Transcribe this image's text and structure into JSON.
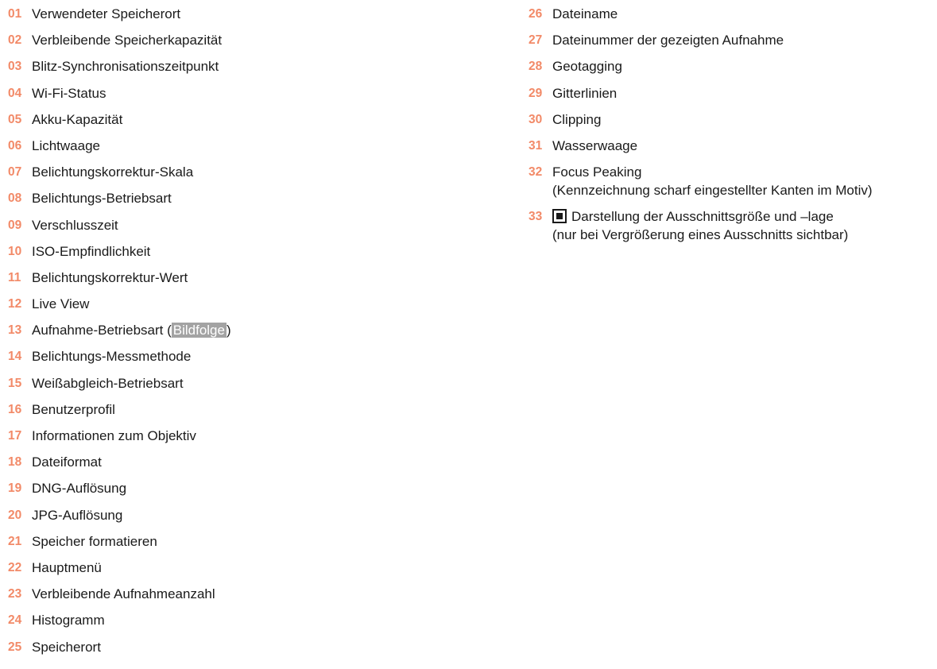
{
  "colors": {
    "number": "#f28a68",
    "text": "#1a1a1a",
    "highlight_bg": "#a3a3a3"
  },
  "left_items": [
    {
      "num": "01",
      "label": "Verwendeter Speicherort"
    },
    {
      "num": "02",
      "label": "Verbleibende Speicherkapazität"
    },
    {
      "num": "03",
      "label": "Blitz-Synchronisationszeitpunkt"
    },
    {
      "num": "04",
      "label": "Wi-Fi-Status"
    },
    {
      "num": "05",
      "label": "Akku-Kapazität"
    },
    {
      "num": "06",
      "label": "Lichtwaage"
    },
    {
      "num": "07",
      "label": "Belichtungskorrektur-Skala"
    },
    {
      "num": "08",
      "label": "Belichtungs-Betriebsart"
    },
    {
      "num": "09",
      "label": "Verschlusszeit"
    },
    {
      "num": "10",
      "label": "ISO-Empfindlichkeit"
    },
    {
      "num": "11",
      "label": "Belichtungskorrektur-Wert"
    },
    {
      "num": "12",
      "label": "Live View"
    },
    {
      "num": "13",
      "label_pre": "Aufnahme-Betriebsart (",
      "label_chip": "Bildfolge",
      "label_post": ")"
    },
    {
      "num": "14",
      "label": "Belichtungs-Messmethode"
    },
    {
      "num": "15",
      "label": "Weißabgleich-Betriebsart"
    },
    {
      "num": "16",
      "label": "Benutzerprofil"
    },
    {
      "num": "17",
      "label": "Informationen zum Objektiv"
    },
    {
      "num": "18",
      "label": "Dateiformat"
    },
    {
      "num": "19",
      "label": "DNG-Auflösung"
    },
    {
      "num": "20",
      "label": "JPG-Auflösung"
    },
    {
      "num": "21",
      "label": "Speicher formatieren"
    },
    {
      "num": "22",
      "label": "Hauptmenü"
    },
    {
      "num": "23",
      "label": "Verbleibende Aufnahmeanzahl"
    },
    {
      "num": "24",
      "label": "Histogramm"
    },
    {
      "num": "25",
      "label": "Speicherort"
    }
  ],
  "right_items": [
    {
      "num": "26",
      "label": "Dateiname"
    },
    {
      "num": "27",
      "label": "Dateinummer der gezeigten Aufnahme"
    },
    {
      "num": "28",
      "label": "Geotagging"
    },
    {
      "num": "29",
      "label": "Gitterlinien"
    },
    {
      "num": "30",
      "label": "Clipping"
    },
    {
      "num": "31",
      "label": "Wasserwaage"
    },
    {
      "num": "32",
      "label": "Focus Peaking",
      "label2": "(Kennzeichnung scharf eingestellter Kanten im Motiv)"
    },
    {
      "num": "33",
      "icon": "frame-square-icon",
      "label": "Darstellung der Ausschnittsgröße und –lage",
      "label2": "(nur bei Vergrößerung eines Ausschnitts sichtbar)"
    }
  ]
}
